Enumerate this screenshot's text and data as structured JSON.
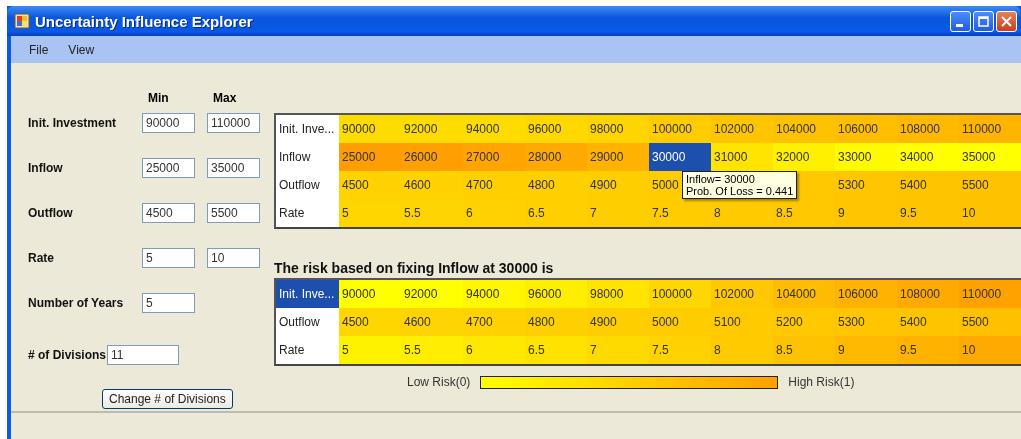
{
  "window": {
    "title": "Uncertainty Influence Explorer"
  },
  "menu": [
    {
      "label": "File"
    },
    {
      "label": "View"
    }
  ],
  "inputs": {
    "columns": [
      "Min",
      "Max"
    ],
    "rows": [
      {
        "label": "Init. Investment",
        "min": "90000",
        "max": "110000"
      },
      {
        "label": "Inflow",
        "min": "25000",
        "max": "35000"
      },
      {
        "label": "Outflow",
        "min": "4500",
        "max": "5500"
      },
      {
        "label": "Rate",
        "min": "5",
        "max": "10"
      }
    ],
    "years": {
      "label": "Number of Years",
      "value": "5"
    },
    "divisions": {
      "label": "# of Divisions",
      "value": "11"
    },
    "button": "Change # of Divisions"
  },
  "grid_top": {
    "rows": [
      {
        "header": "Init. Inve...",
        "selected": false,
        "cells": [
          {
            "text": "90000",
            "color": "#ffdc00",
            "selected": false
          },
          {
            "text": "92000",
            "color": "#ffdc00",
            "selected": false
          },
          {
            "text": "94000",
            "color": "#ffdc00",
            "selected": false
          },
          {
            "text": "96000",
            "color": "#ffd800",
            "selected": false
          },
          {
            "text": "98000",
            "color": "#ffd400",
            "selected": false
          },
          {
            "text": "100000",
            "color": "#ffcc00",
            "selected": false
          },
          {
            "text": "102000",
            "color": "#ffc600",
            "selected": false
          },
          {
            "text": "104000",
            "color": "#ffc200",
            "selected": false
          },
          {
            "text": "106000",
            "color": "#ffbe00",
            "selected": false
          },
          {
            "text": "108000",
            "color": "#ffba00",
            "selected": false
          },
          {
            "text": "110000",
            "color": "#ffb400",
            "selected": false
          }
        ]
      },
      {
        "header": "Inflow",
        "selected": false,
        "cells": [
          {
            "text": "25000",
            "color": "#ff9e00",
            "selected": false
          },
          {
            "text": "26000",
            "color": "#ffa000",
            "selected": false
          },
          {
            "text": "27000",
            "color": "#ffa400",
            "selected": false
          },
          {
            "text": "28000",
            "color": "#ffaa00",
            "selected": false
          },
          {
            "text": "29000",
            "color": "#ffb200",
            "selected": false
          },
          {
            "text": "30000",
            "selected": true
          },
          {
            "text": "31000",
            "color": "#ffe400",
            "selected": false
          },
          {
            "text": "32000",
            "color": "#fff000",
            "selected": false
          },
          {
            "text": "33000",
            "color": "#fffa00",
            "selected": false
          },
          {
            "text": "34000",
            "color": "#ffff00",
            "selected": false
          },
          {
            "text": "35000",
            "color": "#ffff00",
            "selected": false
          }
        ]
      },
      {
        "header": "Outflow",
        "selected": false,
        "cells": [
          {
            "text": "4500",
            "color": "#ffd200",
            "selected": false
          },
          {
            "text": "4600",
            "color": "#ffd200",
            "selected": false
          },
          {
            "text": "4700",
            "color": "#ffd000",
            "selected": false
          },
          {
            "text": "4800",
            "color": "#ffd000",
            "selected": false
          },
          {
            "text": "4900",
            "color": "#ffce00",
            "selected": false
          },
          {
            "text": "5000",
            "color": "#ffcc00",
            "selected": false
          },
          null,
          {
            "color": "#ffc800",
            "selected": false
          },
          {
            "text": "5300",
            "color": "#ffc600",
            "selected": false
          },
          {
            "text": "5400",
            "color": "#ffc400",
            "selected": false
          },
          {
            "text": "5500",
            "color": "#ffc200",
            "selected": false
          }
        ]
      },
      {
        "header": "Rate",
        "selected": false,
        "cells": [
          {
            "text": "5",
            "color": "#ffd600",
            "selected": false
          },
          {
            "text": "5.5",
            "color": "#ffd400",
            "selected": false
          },
          {
            "text": "6",
            "color": "#ffd200",
            "selected": false
          },
          {
            "text": "6.5",
            "color": "#ffd000",
            "selected": false
          },
          {
            "text": "7",
            "color": "#ffce00",
            "selected": false
          },
          {
            "text": "7.5",
            "color": "#ffcc00",
            "selected": false
          },
          {
            "text": "8",
            "color": "#ffca00",
            "selected": false
          },
          {
            "text": "8.5",
            "color": "#ffc800",
            "selected": false
          },
          {
            "text": "9",
            "color": "#ffc600",
            "selected": false
          },
          {
            "text": "9.5",
            "color": "#ffc400",
            "selected": false
          },
          {
            "text": "10",
            "color": "#ffc200",
            "selected": false
          }
        ]
      }
    ]
  },
  "tooltip": {
    "lines": [
      "Inflow= 30000",
      "Prob. Of Loss = 0.441"
    ]
  },
  "caption": "The risk based on fixing Inflow at 30000 is",
  "grid_bottom": {
    "rows": [
      {
        "header": "Init. Inve...",
        "selected": true,
        "cells": [
          {
            "text": "90000",
            "color": "#ffff00",
            "selected": false
          },
          {
            "text": "92000",
            "color": "#ffff00",
            "selected": false
          },
          {
            "text": "94000",
            "color": "#fff600",
            "selected": false
          },
          {
            "text": "96000",
            "color": "#ffee00",
            "selected": false
          },
          {
            "text": "98000",
            "color": "#ffe400",
            "selected": false
          },
          {
            "text": "100000",
            "color": "#ffd600",
            "selected": false
          },
          {
            "text": "102000",
            "color": "#ffc800",
            "selected": false
          },
          {
            "text": "104000",
            "color": "#ffbc00",
            "selected": false
          },
          {
            "text": "106000",
            "color": "#ffb200",
            "selected": false
          },
          {
            "text": "108000",
            "color": "#ffaa00",
            "selected": false
          },
          {
            "text": "110000",
            "color": "#ffa200",
            "selected": false
          }
        ]
      },
      {
        "header": "Outflow",
        "selected": false,
        "cells": [
          {
            "text": "4500",
            "color": "#ffd600",
            "selected": false
          },
          {
            "text": "4600",
            "color": "#ffd400",
            "selected": false
          },
          {
            "text": "4700",
            "color": "#ffd200",
            "selected": false
          },
          {
            "text": "4800",
            "color": "#ffd000",
            "selected": false
          },
          {
            "text": "4900",
            "color": "#ffce00",
            "selected": false
          },
          {
            "text": "5000",
            "color": "#ffcc00",
            "selected": false
          },
          {
            "text": "5100",
            "color": "#ffca00",
            "selected": false
          },
          {
            "text": "5200",
            "color": "#ffc800",
            "selected": false
          },
          {
            "text": "5300",
            "color": "#ffc600",
            "selected": false
          },
          {
            "text": "5400",
            "color": "#ffc400",
            "selected": false
          },
          {
            "text": "5500",
            "color": "#ffc000",
            "selected": false
          }
        ]
      },
      {
        "header": "Rate",
        "selected": false,
        "cells": [
          {
            "text": "5",
            "color": "#fff200",
            "selected": false
          },
          {
            "text": "5.5",
            "color": "#ffee00",
            "selected": false
          },
          {
            "text": "6",
            "color": "#ffe800",
            "selected": false
          },
          {
            "text": "6.5",
            "color": "#ffe200",
            "selected": false
          },
          {
            "text": "7",
            "color": "#ffda00",
            "selected": false
          },
          {
            "text": "7.5",
            "color": "#ffd200",
            "selected": false
          },
          {
            "text": "8",
            "color": "#ffca00",
            "selected": false
          },
          {
            "text": "8.5",
            "color": "#ffc200",
            "selected": false
          },
          {
            "text": "9",
            "color": "#ffba00",
            "selected": false
          },
          {
            "text": "9.5",
            "color": "#ffb200",
            "selected": false
          },
          {
            "text": "10",
            "color": "#ffaa00",
            "selected": false
          }
        ]
      }
    ]
  },
  "legend": {
    "low": "Low Risk(0)",
    "high": "High Risk(1)"
  }
}
